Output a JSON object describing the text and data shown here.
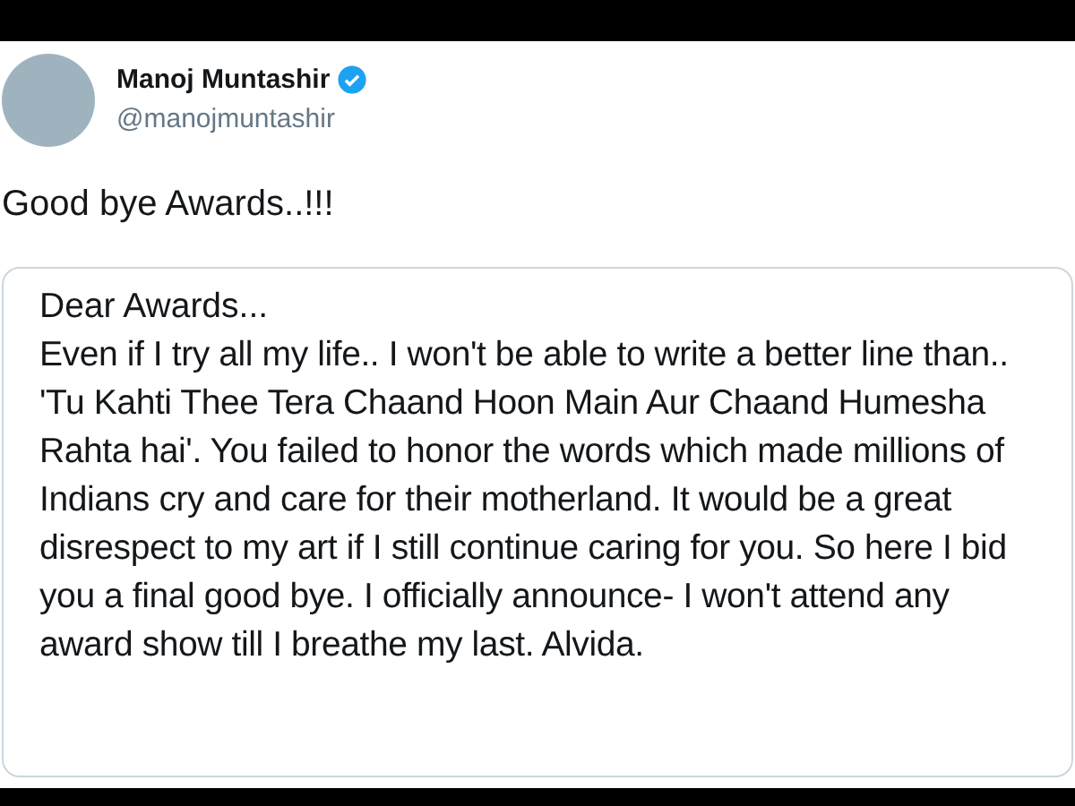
{
  "tweet": {
    "author": {
      "name": "Manoj Muntashir",
      "verified": true,
      "handle": "@manojmuntashir"
    },
    "text": "Good bye Awards..!!!",
    "note": {
      "salutation": "Dear Awards...",
      "body": "Even if I try all my life.. I won't be able to write a better line than.. 'Tu Kahti Thee Tera Chaand Hoon Main Aur Chaand Humesha Rahta hai'. You failed to honor the words which made millions of Indians cry and care for their motherland. It would be a great disrespect to my art if I still continue caring for you. So here I bid you a final good bye. I officially announce- I won't attend any award show till I breathe my last. Alvida."
    }
  }
}
